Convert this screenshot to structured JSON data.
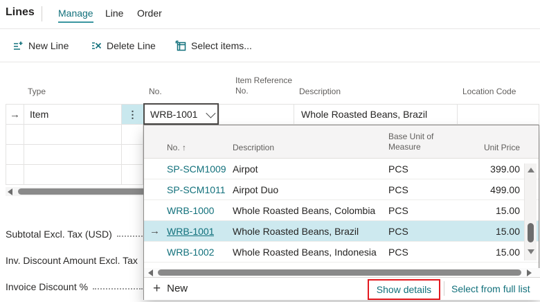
{
  "header": {
    "title": "Lines",
    "tabs": [
      {
        "label": "Manage",
        "active": true
      },
      {
        "label": "Line",
        "active": false
      },
      {
        "label": "Order",
        "active": false
      }
    ]
  },
  "toolbar": {
    "buttons": [
      {
        "label": "New Line",
        "icon": "new-line-icon"
      },
      {
        "label": "Delete Line",
        "icon": "delete-line-icon"
      },
      {
        "label": "Select items...",
        "icon": "select-items-icon"
      }
    ]
  },
  "table": {
    "columns": {
      "type": "Type",
      "no": "No.",
      "item_reference": "Item Reference No.",
      "description": "Description",
      "location_code": "Location Code"
    },
    "row": {
      "type": "Item",
      "no": "WRB-1001",
      "item_reference": "",
      "description": "Whole Roasted Beans, Brazil",
      "location_code": ""
    }
  },
  "totals": {
    "subtotal_label": "Subtotal Excl. Tax (USD)",
    "inv_discount_label": "Inv. Discount Amount Excl. Tax",
    "invoice_discount_pct_label": "Invoice Discount %"
  },
  "dropdown": {
    "columns": {
      "no": "No.",
      "description": "Description",
      "base_unit": "Base Unit of Measure",
      "unit_price": "Unit Price"
    },
    "rows": [
      {
        "no": "SP-SCM1009",
        "description": "Airpot",
        "base_unit": "PCS",
        "unit_price": "399.00"
      },
      {
        "no": "SP-SCM1011",
        "description": "Airpot Duo",
        "base_unit": "PCS",
        "unit_price": "499.00"
      },
      {
        "no": "WRB-1000",
        "description": "Whole Roasted Beans, Colombia",
        "base_unit": "PCS",
        "unit_price": "15.00"
      },
      {
        "no": "WRB-1001",
        "description": "Whole Roasted Beans, Brazil",
        "base_unit": "PCS",
        "unit_price": "15.00"
      },
      {
        "no": "WRB-1002",
        "description": "Whole Roasted Beans, Indonesia",
        "base_unit": "PCS",
        "unit_price": "15.00"
      }
    ],
    "selected_no": "WRB-1001",
    "footer": {
      "new_label": "New",
      "show_details_label": "Show details",
      "select_full_list_label": "Select from full list"
    }
  },
  "icons": {
    "sort_asc": "↑",
    "row_arrow": "→",
    "ellipsis": "⋮",
    "plus": "+"
  },
  "colors": {
    "accent_teal": "#11707b",
    "selection_highlight": "#cde9ef",
    "annotation_red": "#e3191f"
  }
}
